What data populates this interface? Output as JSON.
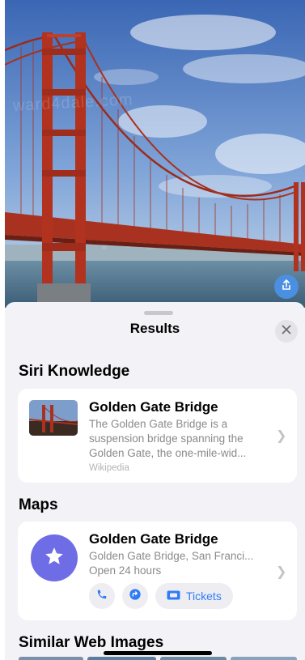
{
  "photo": {
    "subject": "bridge-photo",
    "watermark": "ward4dale.com"
  },
  "share_icon": "share-icon",
  "sheet": {
    "title": "Results",
    "close_icon": "close-icon"
  },
  "siri_knowledge": {
    "section_title": "Siri Knowledge",
    "title": "Golden Gate Bridge",
    "description_lines": [
      "The Golden Gate Bridge is a",
      "suspension bridge spanning the",
      "Golden Gate, the one-mile-wid..."
    ],
    "source": "Wikipedia"
  },
  "maps": {
    "section_title": "Maps",
    "title": "Golden Gate Bridge",
    "address": "Golden Gate Bridge, San Franci...",
    "hours": "Open 24 hours",
    "tickets_label": "Tickets",
    "icon": "star-icon"
  },
  "similar": {
    "section_title": "Similar Web Images"
  },
  "colors": {
    "accent": "#2f7cf6",
    "maps_icon_bg": "#6e6de6",
    "sheet_bg": "#f2f2f7",
    "bridge_red": "#b0321f"
  }
}
